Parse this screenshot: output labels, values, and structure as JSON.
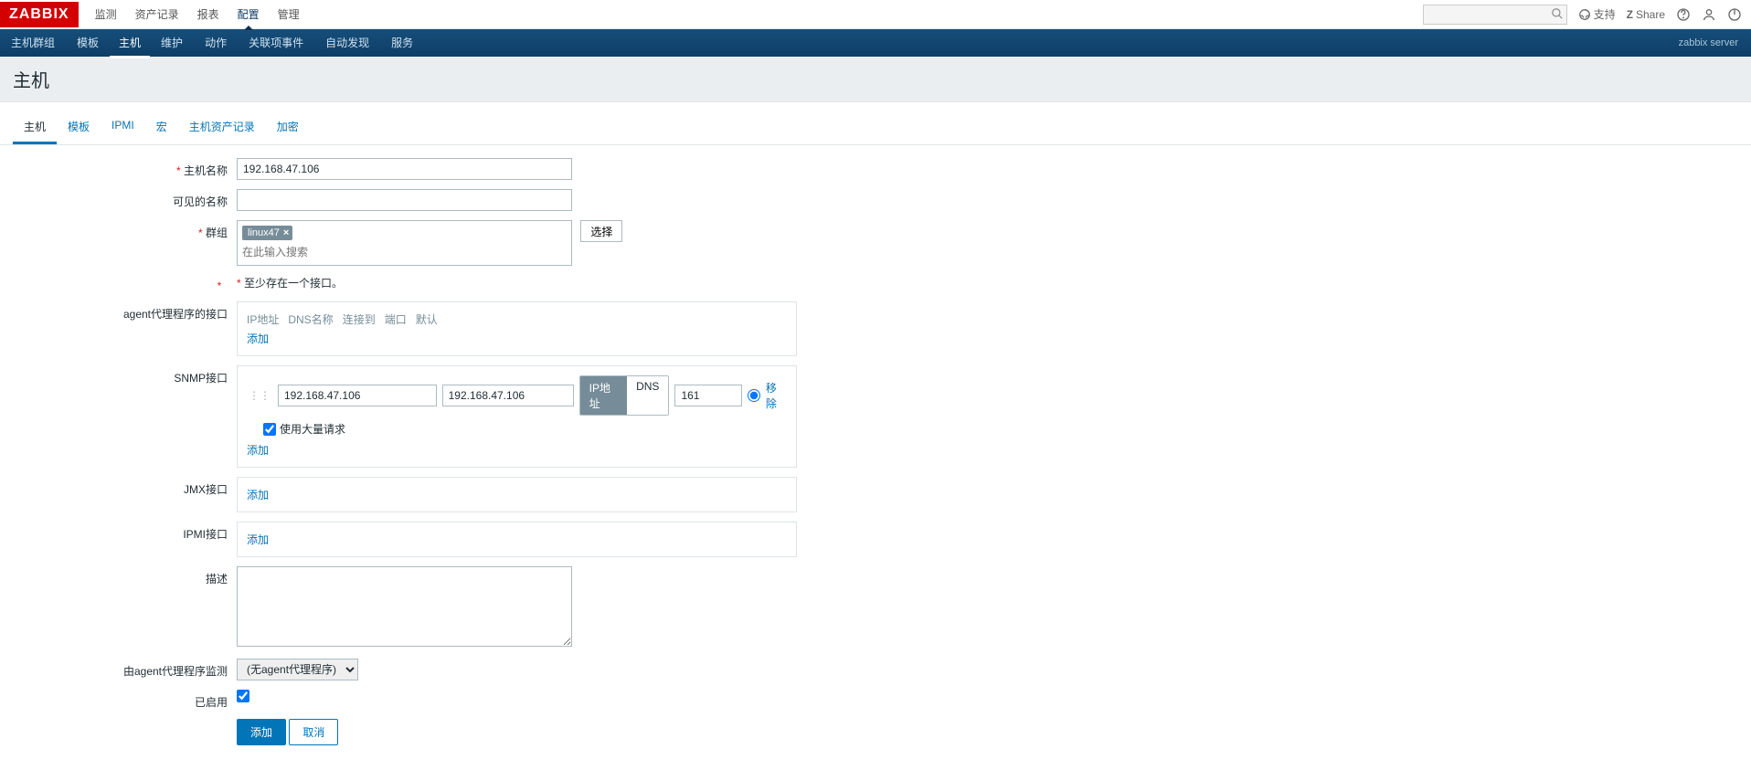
{
  "logo": "ZABBIX",
  "topnav": {
    "items": [
      "监测",
      "资产记录",
      "报表",
      "配置",
      "管理"
    ],
    "active_index": 3
  },
  "topright": {
    "support": "支持",
    "share": "Share"
  },
  "subnav": {
    "items": [
      "主机群组",
      "模板",
      "主机",
      "维护",
      "动作",
      "关联项事件",
      "自动发现",
      "服务"
    ],
    "active_index": 2,
    "right_text": "zabbix server"
  },
  "page_title": "主机",
  "tabs": {
    "items": [
      "主机",
      "模板",
      "IPMI",
      "宏",
      "主机资产记录",
      "加密"
    ],
    "active_index": 0
  },
  "form": {
    "labels": {
      "host_name": "主机名称",
      "visible_name": "可见的名称",
      "groups": "群组",
      "at_least_one": "至少存在一个接口。",
      "agent_iface": "agent代理程序的接口",
      "snmp_iface": "SNMP接口",
      "jmx_iface": "JMX接口",
      "ipmi_iface": "IPMI接口",
      "description": "描述",
      "proxy": "由agent代理程序监测",
      "enabled": "已启用"
    },
    "values": {
      "host_name": "192.168.47.106",
      "visible_name": "",
      "group_chip": "linux47",
      "group_placeholder": "在此输入搜索",
      "select_btn": "选择",
      "add_link": "添加",
      "remove_link": "移除",
      "iface_head_ip": "IP地址",
      "iface_head_dns": "DNS名称",
      "iface_head_conn": "连接到",
      "iface_head_port": "端口",
      "iface_head_default": "默认",
      "snmp_ip": "192.168.47.106",
      "snmp_dns": "192.168.47.106",
      "conn_ip": "IP地址",
      "conn_dns": "DNS",
      "snmp_port": "161",
      "bulk_label": "使用大量请求",
      "proxy_option": "(无agent代理程序)",
      "submit": "添加",
      "cancel": "取消"
    }
  }
}
